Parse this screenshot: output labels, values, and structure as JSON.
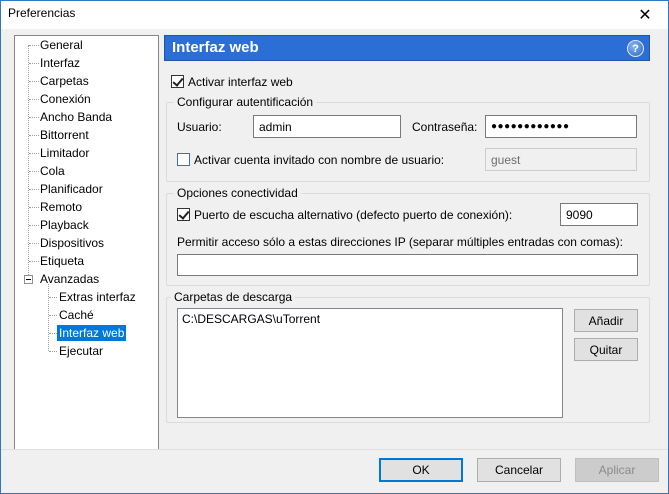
{
  "window": {
    "title": "Preferencias"
  },
  "tree": {
    "items": [
      {
        "label": "General"
      },
      {
        "label": "Interfaz"
      },
      {
        "label": "Carpetas"
      },
      {
        "label": "Conexión"
      },
      {
        "label": "Ancho Banda"
      },
      {
        "label": "Bittorrent"
      },
      {
        "label": "Limitador"
      },
      {
        "label": "Cola"
      },
      {
        "label": "Planificador"
      },
      {
        "label": "Remoto"
      },
      {
        "label": "Playback"
      },
      {
        "label": "Dispositivos"
      },
      {
        "label": "Etiqueta"
      },
      {
        "label": "Avanzadas"
      }
    ],
    "children": [
      {
        "label": "Extras interfaz"
      },
      {
        "label": "Caché"
      },
      {
        "label": "Interfaz web",
        "selected": true
      },
      {
        "label": "Ejecutar"
      }
    ]
  },
  "panel": {
    "title": "Interfaz web",
    "help_icon": "?",
    "enable_label": "Activar interfaz web",
    "auth": {
      "group_title": "Configurar autentificación",
      "user_label": "Usuario:",
      "user_value": "admin",
      "password_label": "Contraseña:",
      "password_value": "●●●●●●●●●●●●",
      "guest_label": "Activar cuenta invitado con nombre de usuario:",
      "guest_value": "guest"
    },
    "connectivity": {
      "group_title": "Opciones conectividad",
      "alt_port_label": "Puerto de escucha alternativo (defecto puerto de conexión):",
      "alt_port_value": "9090",
      "ip_label": "Permitir acceso sólo a estas direcciones IP (separar múltiples entradas con comas):",
      "ip_value": ""
    },
    "downloads": {
      "group_title": "Carpetas de descarga",
      "folders": [
        "C:\\DESCARGAS\\uTorrent"
      ],
      "add_label": "Añadir",
      "remove_label": "Quitar"
    }
  },
  "footer": {
    "ok_label": "OK",
    "cancel_label": "Cancelar",
    "apply_label": "Aplicar"
  }
}
